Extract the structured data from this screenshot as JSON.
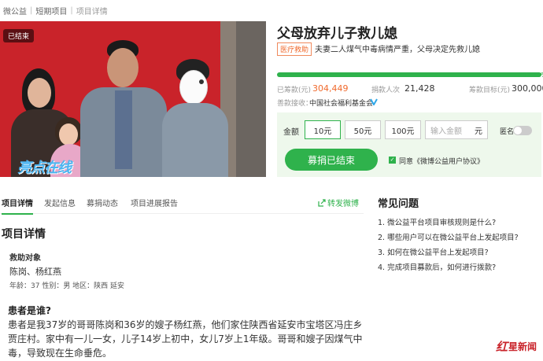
{
  "breadcrumb": {
    "home": "微公益",
    "category": "短期项目",
    "current": "项目详情",
    "separator": "|"
  },
  "photo": {
    "status_badge": "已结束",
    "watermark": "亮点在线"
  },
  "project": {
    "title": "父母放弃儿子救儿媳",
    "tag": "医疗救助",
    "subtitle": "夫妻二人煤气中毒病情严重，父母决定先救儿媳"
  },
  "progress": {
    "percent_text": "101.48%",
    "percent": 101.48
  },
  "stats": {
    "raised_label": "已筹款(元)",
    "raised_value": "304,449",
    "donors_label": "捐款人次",
    "donors_value": "21,428",
    "goal_label": "筹款目标(元)",
    "goal_value": "300,000"
  },
  "receiver": {
    "label": "善款接收：",
    "name": "中国社会福利基金会"
  },
  "donate": {
    "amount_label": "金额",
    "options": [
      "10元",
      "50元",
      "100元"
    ],
    "input_placeholder": "输入金额",
    "input_unit": "元",
    "anonymous_label": "匿名",
    "button_label": "募捐已结束",
    "agreement": "同意《微博公益用户协议》"
  },
  "tabs": [
    "项目详情",
    "发起信息",
    "募捐动态",
    "项目进展报告"
  ],
  "share_label": "转发微博",
  "detail": {
    "section_title": "项目详情",
    "help_label": "救助对象",
    "help_names": "陈岗、杨红燕",
    "help_info": "年龄：37  性别：男  地区：陕西 延安",
    "question": "患者是谁?",
    "story": "患者是我37岁的哥哥陈岗和36岁的嫂子杨红燕，他们家住陕西省延安市宝塔区冯庄乡贾庄村。家中有一儿一女，儿子14岁上初中，女儿7岁上1年级。哥哥和嫂子因煤气中毒，导致现在生命垂危。"
  },
  "faq": {
    "title": "常见问题",
    "items": [
      "1. 微公益平台项目审核规则是什么?",
      "2. 哪些用户可以在微公益平台上发起项目?",
      "3. 如何在微公益平台上发起项目?",
      "4. 完成项目募款后，如何进行拨款?"
    ]
  },
  "news_logo": {
    "red": "红",
    "rest": "星新闻"
  },
  "colors": {
    "accent_green": "#2fb24c",
    "orange": "#f06a2d",
    "photo_red": "#c9232a"
  }
}
